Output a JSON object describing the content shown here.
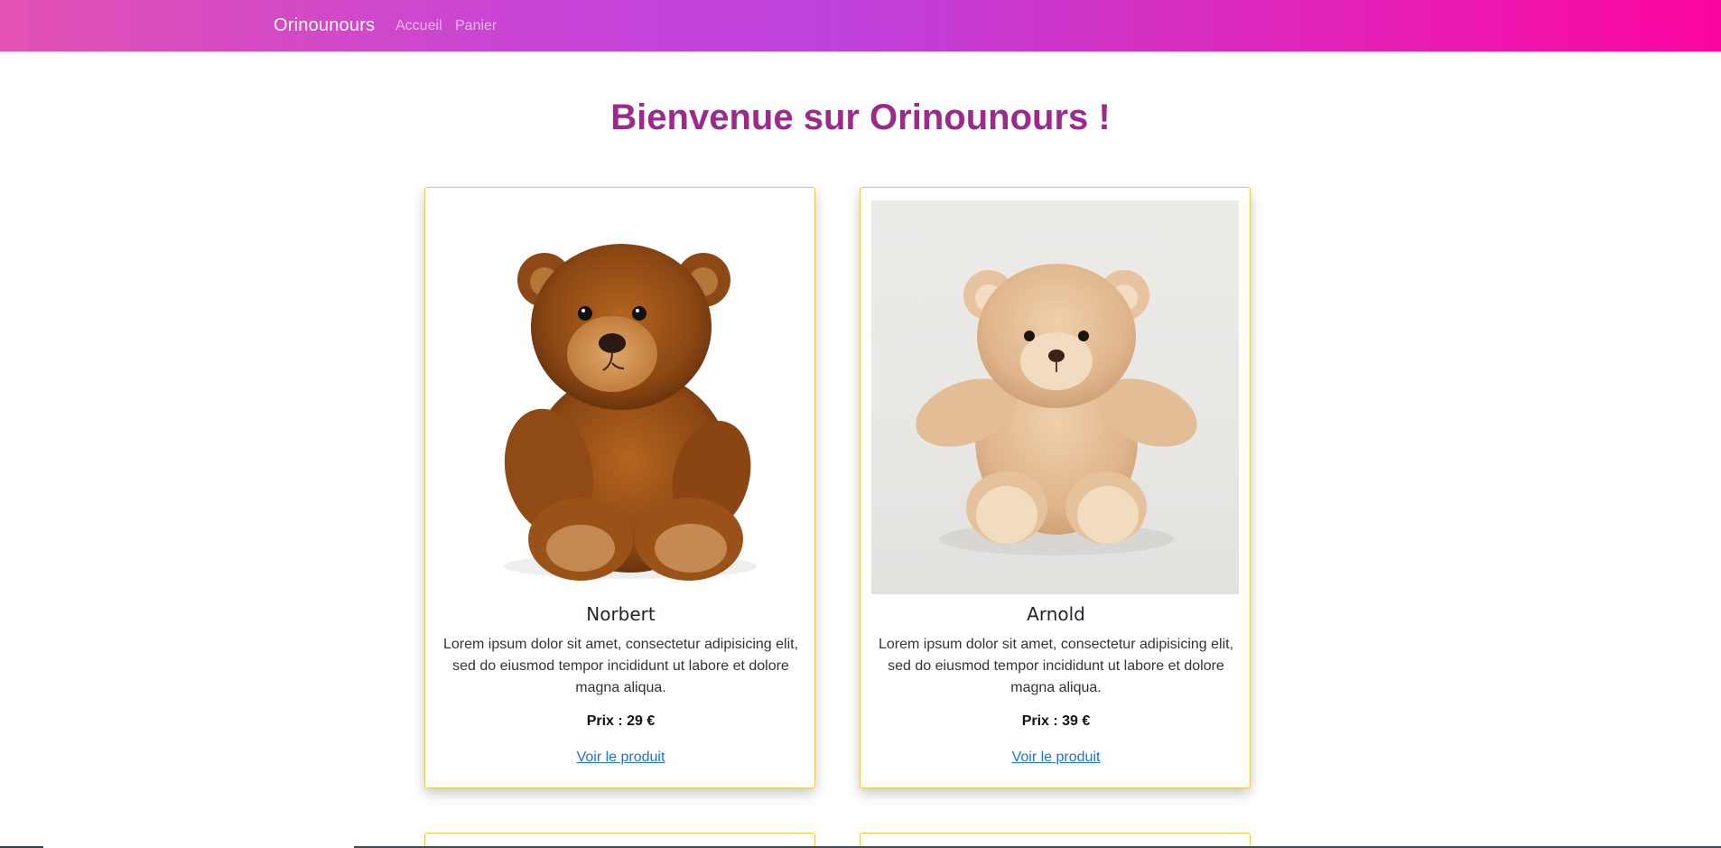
{
  "nav": {
    "brand": "Orinounours",
    "links": [
      "Accueil",
      "Panier"
    ],
    "gradient_colors": [
      "#e252b4",
      "#bd42dd",
      "#fd05a0"
    ]
  },
  "page_title": "Bienvenue sur Orinounours !",
  "accent_color": "#9b2a8c",
  "card_border_color": "#f2c94c",
  "products": [
    {
      "image": "teddy-bear-brown-photo",
      "name": "Norbert",
      "description": "Lorem ipsum dolor sit amet, consectetur adipisicing elit, sed do eiusmod tempor incididunt ut labore et dolore magna aliqua.",
      "price": "Prix : 29 €",
      "link": "Voir le produit"
    },
    {
      "image": "teddy-bear-beige-photo",
      "name": "Arnold",
      "description": "Lorem ipsum dolor sit amet, consectetur adipisicing elit, sed do eiusmod tempor incididunt ut labore et dolore magna aliqua.",
      "price": "Prix : 39 €",
      "link": "Voir le produit"
    }
  ]
}
